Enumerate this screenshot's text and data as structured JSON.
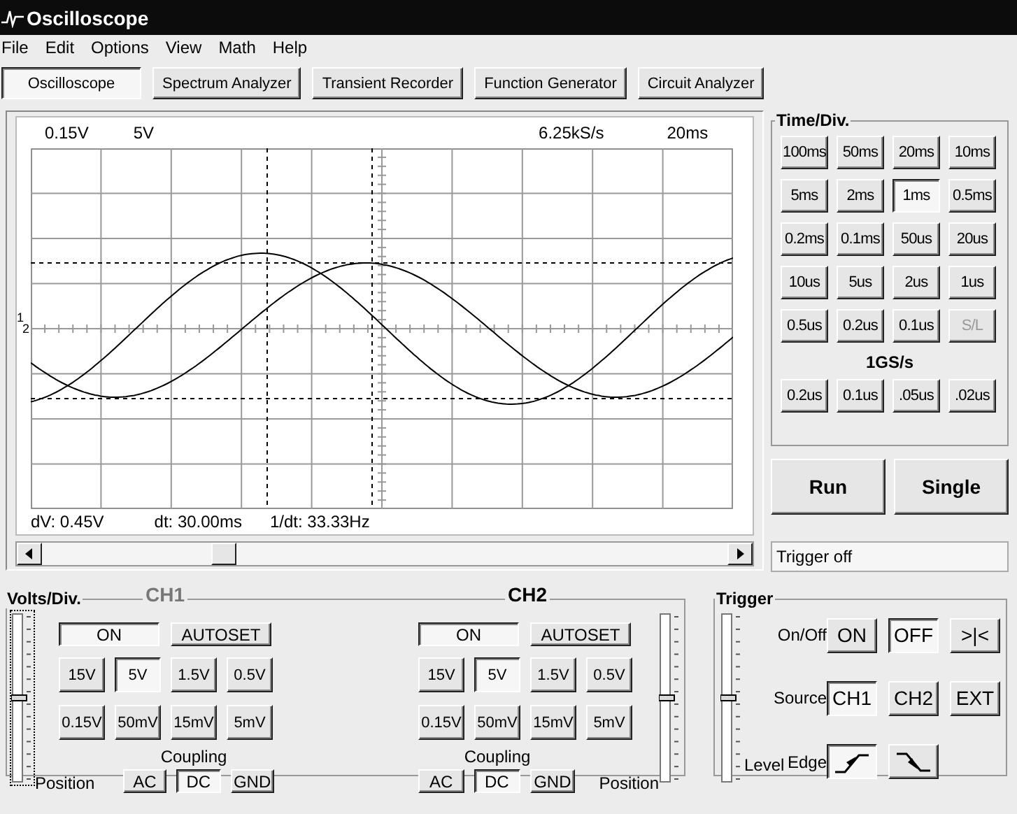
{
  "window": {
    "title": "Oscilloscope"
  },
  "menu": [
    "File",
    "Edit",
    "Options",
    "View",
    "Math",
    "Help"
  ],
  "tabs": [
    {
      "label": "Oscilloscope",
      "selected": true
    },
    {
      "label": "Spectrum Analyzer",
      "selected": false
    },
    {
      "label": "Transient Recorder",
      "selected": false
    },
    {
      "label": "Function Generator",
      "selected": false
    },
    {
      "label": "Circuit Analyzer",
      "selected": false
    }
  ],
  "display": {
    "readouts_top": [
      "0.15V",
      "5V",
      "6.25kS/s",
      "20ms"
    ],
    "channel_markers": [
      "1",
      "2"
    ],
    "readouts_bottom": [
      "dV: 0.45V",
      "dt: 30.00ms",
      "1/dt: 33.33Hz"
    ]
  },
  "time_div": {
    "title": "Time/Div.",
    "buttons": [
      {
        "label": "100ms",
        "selected": false,
        "disabled": false
      },
      {
        "label": "50ms",
        "selected": false,
        "disabled": false
      },
      {
        "label": "20ms",
        "selected": false,
        "disabled": false
      },
      {
        "label": "10ms",
        "selected": false,
        "disabled": false
      },
      {
        "label": "5ms",
        "selected": false,
        "disabled": false
      },
      {
        "label": "2ms",
        "selected": false,
        "disabled": false
      },
      {
        "label": "1ms",
        "selected": true,
        "disabled": false
      },
      {
        "label": "0.5ms",
        "selected": false,
        "disabled": false
      },
      {
        "label": "0.2ms",
        "selected": false,
        "disabled": false
      },
      {
        "label": "0.1ms",
        "selected": false,
        "disabled": false
      },
      {
        "label": "50us",
        "selected": false,
        "disabled": false
      },
      {
        "label": "20us",
        "selected": false,
        "disabled": false
      },
      {
        "label": "10us",
        "selected": false,
        "disabled": false
      },
      {
        "label": "5us",
        "selected": false,
        "disabled": false
      },
      {
        "label": "2us",
        "selected": false,
        "disabled": false
      },
      {
        "label": "1us",
        "selected": false,
        "disabled": false
      },
      {
        "label": "0.5us",
        "selected": false,
        "disabled": false
      },
      {
        "label": "0.2us",
        "selected": false,
        "disabled": false
      },
      {
        "label": "0.1us",
        "selected": false,
        "disabled": false
      },
      {
        "label": "S/L",
        "selected": false,
        "disabled": true
      }
    ],
    "fast_label": "1GS/s",
    "fast_buttons": [
      {
        "label": "0.2us",
        "selected": false
      },
      {
        "label": "0.1us",
        "selected": false
      },
      {
        "label": ".05us",
        "selected": false
      },
      {
        "label": ".02us",
        "selected": false
      }
    ]
  },
  "actions": [
    "Run",
    "Single"
  ],
  "status": "Trigger off",
  "volts_div": {
    "title": "Volts/Div.",
    "channels": [
      {
        "name": "CH1",
        "color": "#777777",
        "on_button": {
          "label": "ON",
          "selected": true
        },
        "autoset": "AUTOSET",
        "volts": [
          {
            "label": "15V",
            "selected": false
          },
          {
            "label": "5V",
            "selected": true
          },
          {
            "label": "1.5V",
            "selected": false
          },
          {
            "label": "0.5V",
            "selected": false
          },
          {
            "label": "0.15V",
            "selected": false
          },
          {
            "label": "50mV",
            "selected": false
          },
          {
            "label": "15mV",
            "selected": false
          },
          {
            "label": "5mV",
            "selected": false
          }
        ],
        "coupling_label": "Coupling",
        "coupling": [
          {
            "label": "AC",
            "selected": false
          },
          {
            "label": "DC",
            "selected": true
          },
          {
            "label": "GND",
            "selected": false
          }
        ],
        "position_label": "Position",
        "position": {
          "level": 0.5
        }
      },
      {
        "name": "CH2",
        "color": "#000000",
        "on_button": {
          "label": "ON",
          "selected": true
        },
        "autoset": "AUTOSET",
        "volts": [
          {
            "label": "15V",
            "selected": false
          },
          {
            "label": "5V",
            "selected": true
          },
          {
            "label": "1.5V",
            "selected": false
          },
          {
            "label": "0.5V",
            "selected": false
          },
          {
            "label": "0.15V",
            "selected": false
          },
          {
            "label": "50mV",
            "selected": false
          },
          {
            "label": "15mV",
            "selected": false
          },
          {
            "label": "5mV",
            "selected": false
          }
        ],
        "coupling_label": "Coupling",
        "coupling": [
          {
            "label": "AC",
            "selected": false
          },
          {
            "label": "DC",
            "selected": true
          },
          {
            "label": "GND",
            "selected": false
          }
        ],
        "position_label": "Position",
        "position": {
          "level": 0.5
        }
      }
    ]
  },
  "trigger": {
    "title": "Trigger",
    "level_label": "Level",
    "level": 0.5,
    "rows": [
      {
        "label": "On/Off",
        "buttons": [
          {
            "kind": "text",
            "label": "ON",
            "selected": false
          },
          {
            "kind": "text",
            "label": "OFF",
            "selected": true
          },
          {
            "kind": "text",
            "label": ">|<",
            "selected": false
          }
        ]
      },
      {
        "label": "Source",
        "buttons": [
          {
            "kind": "text",
            "label": "CH1",
            "selected": true
          },
          {
            "kind": "text",
            "label": "CH2",
            "selected": false
          },
          {
            "kind": "text",
            "label": "EXT",
            "selected": false
          }
        ]
      },
      {
        "label": "Edge",
        "buttons": [
          {
            "kind": "rising",
            "selected": true
          },
          {
            "kind": "falling",
            "selected": false
          }
        ]
      }
    ]
  }
}
